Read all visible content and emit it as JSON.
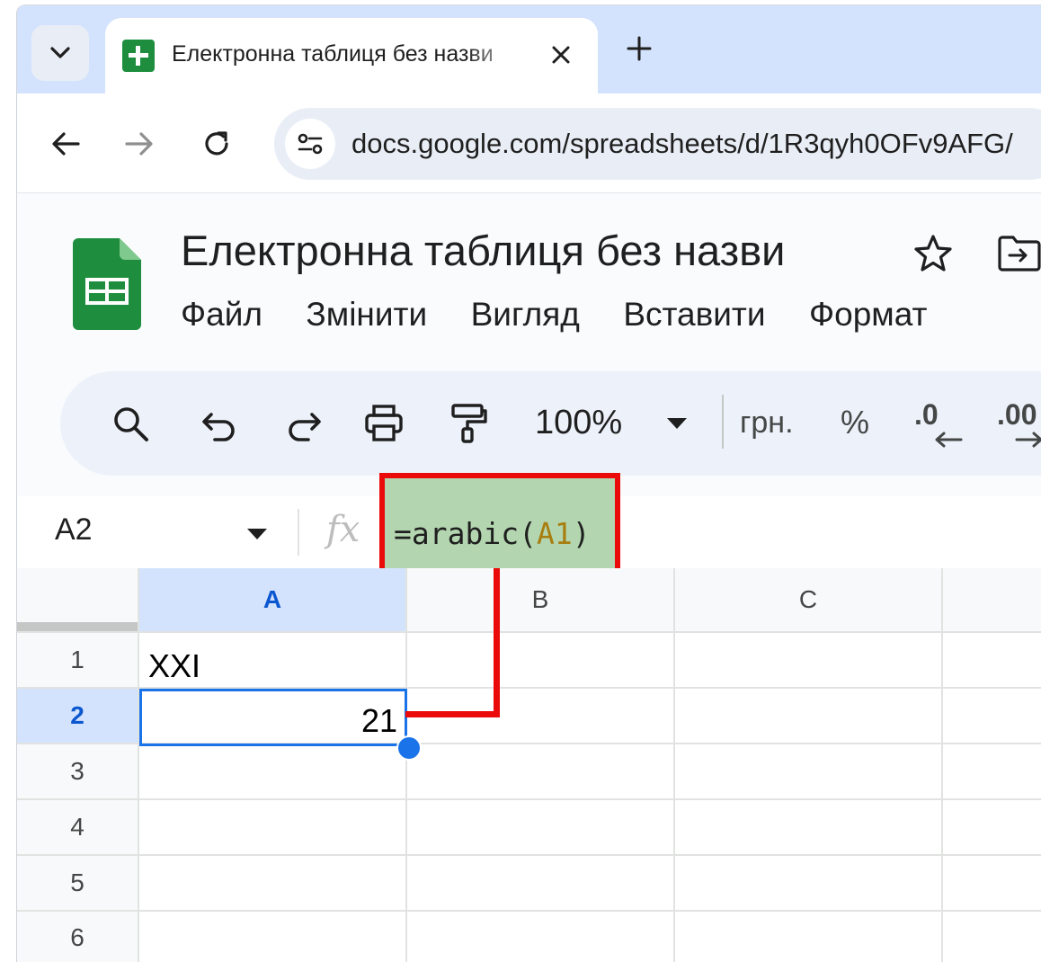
{
  "browser": {
    "tab_title": "Електронна таблиця без назви",
    "address_url": "docs.google.com/spreadsheets/d/1R3qyh0OFv9AFG/"
  },
  "sheets": {
    "doc_title": "Електронна таблиця без назви",
    "menu": [
      "Файл",
      "Змінити",
      "Вигляд",
      "Вставити",
      "Формат"
    ],
    "toolbar": {
      "zoom": "100%",
      "currency": "грн.",
      "percent": "%",
      "decimal_decrease": ".0",
      "decimal_increase": ".00"
    },
    "name_box": "A2",
    "fx_label": "fx",
    "formula": {
      "prefix": "=arabic(",
      "reference": "A1",
      "suffix": ")"
    },
    "columns": [
      "A",
      "B",
      "C"
    ],
    "rows": [
      "1",
      "2",
      "3",
      "4",
      "5",
      "6"
    ],
    "cells": {
      "A1": "XXI",
      "A2": "21"
    }
  },
  "colors": {
    "tabstrip": "#d3e3fd",
    "sheets_green": "#1e8e3e",
    "selection_blue": "#1a73e8",
    "annotation_red": "#ea0a0a",
    "formula_highlight": "#b3d6b0"
  }
}
